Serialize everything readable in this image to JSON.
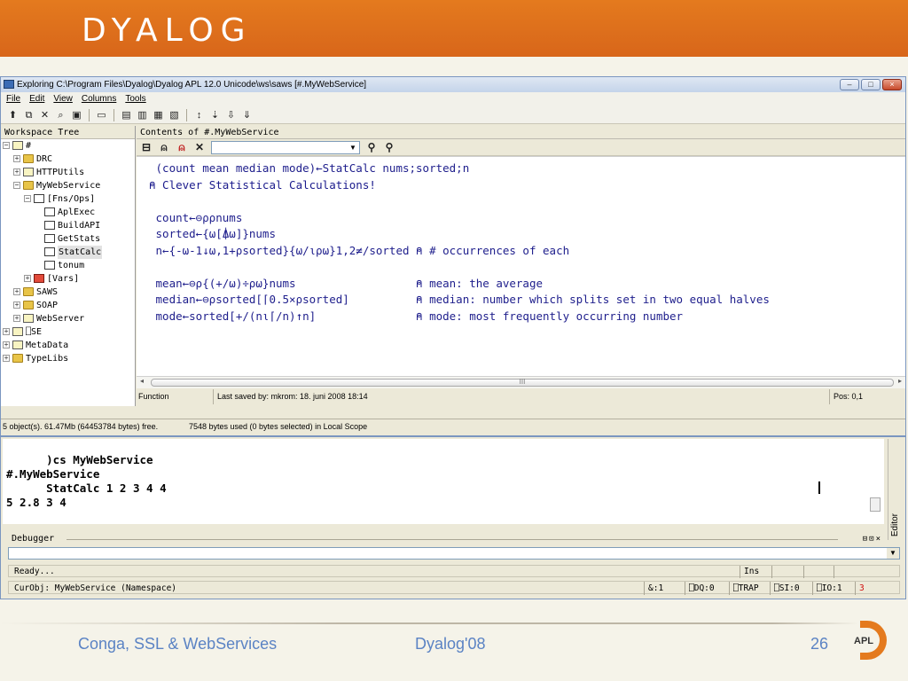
{
  "slide": {
    "logo_text": "DYALOG",
    "footer": {
      "left": "Conga, SSL & WebServices",
      "center": "Dyalog'08",
      "page": "26",
      "badge": "APL"
    }
  },
  "window": {
    "title": "Exploring C:\\Program Files\\Dyalog\\Dyalog APL 12.0 Unicode\\ws\\saws [#.MyWebService]",
    "controls": {
      "minimize": "–",
      "maximize": "□",
      "close": "×"
    },
    "menu": [
      "File",
      "Edit",
      "View",
      "Columns",
      "Tools"
    ],
    "tree_header": "Workspace Tree",
    "contents_header": "Contents of #.MyWebService",
    "tree": [
      {
        "label": "#",
        "level": 0,
        "toggle": "−",
        "icon": "namespace-icon"
      },
      {
        "label": "DRC",
        "level": 1,
        "toggle": "+",
        "icon": "folder-icon"
      },
      {
        "label": "HTTPUtils",
        "level": 1,
        "toggle": "+",
        "icon": "namespace-icon"
      },
      {
        "label": "MyWebService",
        "level": 1,
        "toggle": "−",
        "icon": "folder-icon"
      },
      {
        "label": "[Fns/Ops]",
        "level": 2,
        "toggle": "−",
        "icon": "function-icon"
      },
      {
        "label": "AplExec",
        "level": 3,
        "toggle": "",
        "icon": "function-icon"
      },
      {
        "label": "BuildAPI",
        "level": 3,
        "toggle": "",
        "icon": "function-icon"
      },
      {
        "label": "GetStats",
        "level": 3,
        "toggle": "",
        "icon": "function-icon"
      },
      {
        "label": "StatCalc",
        "level": 3,
        "toggle": "",
        "icon": "function-icon",
        "selected": true
      },
      {
        "label": "tonum",
        "level": 3,
        "toggle": "",
        "icon": "function-icon"
      },
      {
        "label": "[Vars]",
        "level": 2,
        "toggle": "+",
        "icon": "variable-icon"
      },
      {
        "label": "SAWS",
        "level": 1,
        "toggle": "+",
        "icon": "folder-icon"
      },
      {
        "label": "SOAP",
        "level": 1,
        "toggle": "+",
        "icon": "folder-icon"
      },
      {
        "label": "WebServer",
        "level": 1,
        "toggle": "+",
        "icon": "namespace-icon"
      },
      {
        "label": "⎕SE",
        "level": 0,
        "toggle": "+",
        "icon": "namespace-icon"
      },
      {
        "label": "MetaData",
        "level": 0,
        "toggle": "+",
        "icon": "metadata-icon"
      },
      {
        "label": "TypeLibs",
        "level": 0,
        "toggle": "+",
        "icon": "typelibs-icon"
      }
    ],
    "editor_lines": [
      {
        "text": " (count mean median mode)←StatCalc nums;sorted;n",
        "kind": "header"
      },
      {
        "text": "⍝ Clever Statistical Calculations!",
        "kind": "comment"
      },
      {
        "text": "",
        "kind": "blank"
      },
      {
        "text": " count←⊖⍴⍴nums",
        "kind": "code"
      },
      {
        "text": " sorted←{⍵[⍋⍵]}nums",
        "kind": "code"
      },
      {
        "text": " n←{-⍵-1↓⍵,1+⍴sorted}{⍵/⍳⍴⍵}1,2≠/sorted ⍝ # occurrences of each",
        "kind": "code"
      },
      {
        "text": "",
        "kind": "blank"
      },
      {
        "text": " mean←⊖⍴{(+/⍵)÷⍴⍵}nums                  ⍝ mean: the average",
        "kind": "code"
      },
      {
        "text": " median←⊖⍴sorted[⌈0.5×⍴sorted]          ⍝ median: number which splits set in two equal halves",
        "kind": "code"
      },
      {
        "text": " mode←sorted[+/(n⍳⌈/n)↑n]               ⍝ mode: most frequently occurring number",
        "kind": "code"
      }
    ],
    "hscroll_grip": "III",
    "status": {
      "type": "Function",
      "saved": "Last saved by: mkrom: 18. juni 2008 18:14",
      "pos": "Pos: 0,1"
    },
    "footer_status": {
      "objects": "5 object(s). 61.47Mb (64453784 bytes) free.",
      "bytes": "7548 bytes used (0 bytes selected)  in Local Scope"
    }
  },
  "session": {
    "lines": [
      "      )cs MyWebService",
      "#.MyWebService",
      "      StatCalc 1 2 3 4 4",
      "5 2.8 3 4"
    ],
    "editor_tab": "Editor",
    "debugger_label": "Debugger",
    "debugger_buttons": "⊟⊡×",
    "ready": "Ready...",
    "ins": "Ins",
    "curobj": "CurObj: MyWebService (Namespace)",
    "indicators": [
      "&:1",
      "⎕DQ:0",
      "⎕TRAP",
      "⎕SI:0",
      "⎕IO:1",
      "3"
    ]
  }
}
